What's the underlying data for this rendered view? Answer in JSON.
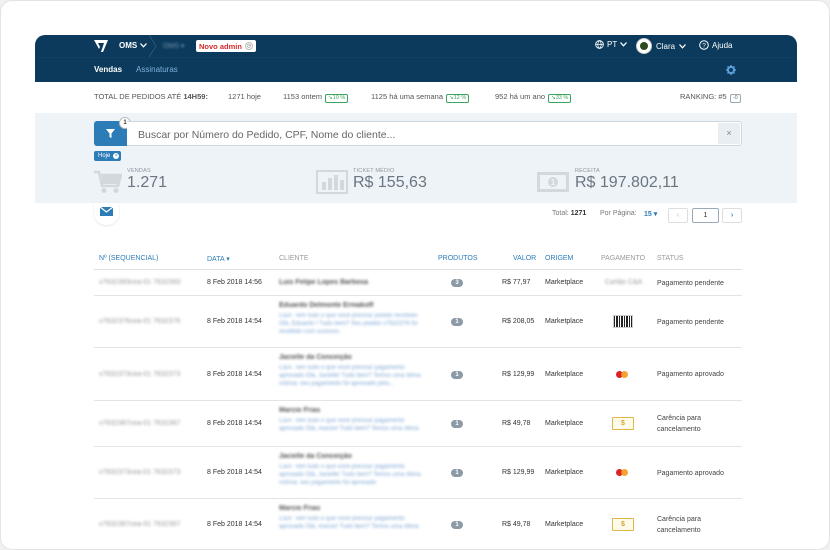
{
  "topbar": {
    "module": "OMS",
    "store_selector": "OMS ▾",
    "new_admin_label": "Novo admin",
    "language": "PT",
    "user_name": "Clara",
    "help_label": "Ajuda"
  },
  "subnav": {
    "tabs": [
      {
        "label": "Vendas",
        "active": true
      },
      {
        "label": "Assinaturas",
        "active": false
      }
    ]
  },
  "totals": {
    "label": "TOTAL DE PEDIDOS ATÉ",
    "time": "14H59:",
    "today": "1271 hoje",
    "yesterday": "1153 ontem",
    "yesterday_pct": "10 %",
    "week": "1125 há uma semana",
    "week_pct": "12 %",
    "year": "952 há um ano",
    "year_pct": "33 %",
    "ranking": "RANKING: #5",
    "ranking_delta": "-0"
  },
  "search": {
    "placeholder": "Buscar por Número do Pedido, CPF, Nome do cliente...",
    "filter_count": "1",
    "clear": "×",
    "active_filter": "Hoje"
  },
  "kpis": {
    "vendas_label": "VENDAS",
    "vendas_value": "1.271",
    "ticket_label": "TICKET MÉDIO",
    "ticket_value": "R$ 155,63",
    "receita_label": "RECEITA",
    "receita_value": "R$ 197.802,11"
  },
  "pager": {
    "total_label": "Total:",
    "total_value": "1271",
    "per_page_label": "Por Página:",
    "per_page_value": "15 ▾",
    "prev": "‹",
    "page": "1",
    "next": "›"
  },
  "table": {
    "headers": {
      "id": "Nº (SEQUENCIAL)",
      "date": "DATA ▾",
      "client": "CLIENTE",
      "products": "PRODUTOS",
      "value": "VALOR",
      "origin": "ORIGEM",
      "payment": "PAGAMENTO",
      "status": "STATUS"
    },
    "rows": [
      {
        "id": "v7632393cea-01 7632393",
        "date": "8 Feb 2018 14:56",
        "client": "Luis Felipe Lopes Barbosa",
        "msg": "",
        "products": "3",
        "value": "R$ 77,97",
        "origin": "Marketplace",
        "payment": "Cartão C&A",
        "status": "Pagamento pendente"
      },
      {
        "id": "v7632376cea-01 7632376",
        "date": "8 Feb 2018 14:54",
        "client": "Eduardo Delmonte Ermakoff",
        "msg": "C&A: Tem tudo o que você precisa! pedido recebido Olá, Eduardo ! Tudo bem? Seu pedido v7632376 foi recebido com sucesso.",
        "products": "1",
        "value": "R$ 208,05",
        "origin": "Marketplace",
        "payment": "barcode",
        "status": "Pagamento pendente"
      },
      {
        "id": "v7632373cea-01 7632373",
        "date": "8 Feb 2018 14:54",
        "client": "Jacielle da Conceição",
        "msg": "C&A: Tem tudo o que você precisa! pagamento aprovado Olá, Jacielle! Tudo bem? Temos uma ótima notícia: seu pagamento foi aprovado pelo...",
        "products": "1",
        "value": "R$ 129,99",
        "origin": "Marketplace",
        "payment": "mastercard",
        "status": "Pagamento aprovado"
      },
      {
        "id": "v7632367cea-01 7632367",
        "date": "8 Feb 2018 14:54",
        "client": "Marcio Frias",
        "msg": "C&A: Tem tudo o que você precisa! pagamento aprovado Olá, marcio! Tudo bem? Temos uma ótima",
        "products": "1",
        "value": "R$ 49,78",
        "origin": "Marketplace",
        "payment": "voucher",
        "status": "Carência para cancelamento"
      },
      {
        "id": "v7632373cea-01 7632373",
        "date": "8 Feb 2018 14:54",
        "client": "Jacielle da Conceição",
        "msg": "C&A: Tem tudo o que você precisa! pagamento aprovado Olá, Jacielle! Tudo bem? Temos uma ótima notícia: seu pagamento foi aprovado",
        "products": "1",
        "value": "R$ 129,99",
        "origin": "Marketplace",
        "payment": "mastercard",
        "status": "Pagamento aprovado"
      },
      {
        "id": "v7632367cea-01 7632367",
        "date": "8 Feb 2018 14:54",
        "client": "Marcio Frias",
        "msg": "C&A: Tem tudo o que você precisa! pagamento aprovado Olá, marcio! Tudo bem? Temos uma ótima",
        "products": "1",
        "value": "R$ 49,78",
        "origin": "Marketplace",
        "payment": "voucher",
        "status": "Carência para cancelamento"
      }
    ]
  }
}
